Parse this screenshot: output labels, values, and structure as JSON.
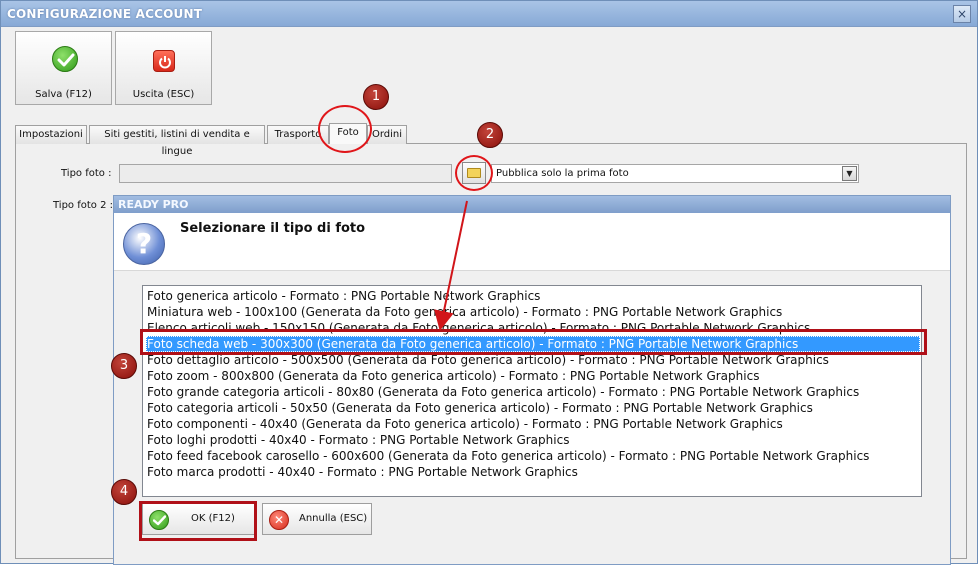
{
  "window": {
    "title": "CONFIGURAZIONE ACCOUNT",
    "close_glyph": "×"
  },
  "toolbar": {
    "save_label": "Salva (F12)",
    "exit_label": "Uscita (ESC)"
  },
  "tabs": [
    {
      "label": "Impostazioni"
    },
    {
      "label": "Siti gestiti, listini di vendita e lingue"
    },
    {
      "label": "Trasporto"
    },
    {
      "label": "Foto",
      "active": true
    },
    {
      "label": "Ordini"
    }
  ],
  "form": {
    "tipo_foto_label": "Tipo foto :",
    "tipo_foto2_label": "Tipo foto 2 :",
    "tipo_foto_value": "",
    "publish_select_value": "Pubblica solo la prima foto",
    "select_arrow_glyph": "▼"
  },
  "dialog": {
    "title": "READY PRO",
    "question_glyph": "?",
    "message": "Selezionare il tipo di foto",
    "items": [
      "Foto generica articolo - Formato : PNG Portable Network Graphics",
      "Miniatura web - 100x100 (Generata da Foto generica articolo) - Formato : PNG Portable Network Graphics",
      "Elenco articoli web - 150x150 (Generata da Foto generica articolo) - Formato : PNG Portable Network Graphics",
      "Foto scheda web - 300x300 (Generata da Foto generica articolo) - Formato : PNG Portable Network Graphics",
      "Foto dettaglio articolo - 500x500 (Generata da Foto generica articolo) - Formato : PNG Portable Network Graphics",
      "Foto zoom - 800x800 (Generata da Foto generica articolo) - Formato : PNG Portable Network Graphics",
      "Foto grande categoria articoli - 80x80 (Generata da Foto generica articolo) - Formato : PNG Portable Network Graphics",
      "Foto categoria articoli - 50x50 (Generata da Foto generica articolo) - Formato : PNG Portable Network Graphics",
      "Foto componenti - 40x40 (Generata da Foto generica articolo) - Formato : PNG Portable Network Graphics",
      "Foto loghi prodotti - 40x40 - Formato : PNG Portable Network Graphics",
      "Foto feed facebook carosello - 600x600 (Generata da Foto generica articolo) - Formato : PNG Portable Network Graphics",
      "Foto marca prodotti - 40x40 - Formato : PNG Portable Network Graphics"
    ],
    "selected_index": 3,
    "ok_label": "OK (F12)",
    "cancel_label": "Annulla (ESC)",
    "cancel_glyph": "✕"
  },
  "annotations": {
    "badges": [
      "1",
      "2",
      "3",
      "4"
    ],
    "color": "#e0161a"
  },
  "colors": {
    "title_bar": "#87a9d6",
    "selection": "#3399ff",
    "badge": "#8a0f0a"
  }
}
